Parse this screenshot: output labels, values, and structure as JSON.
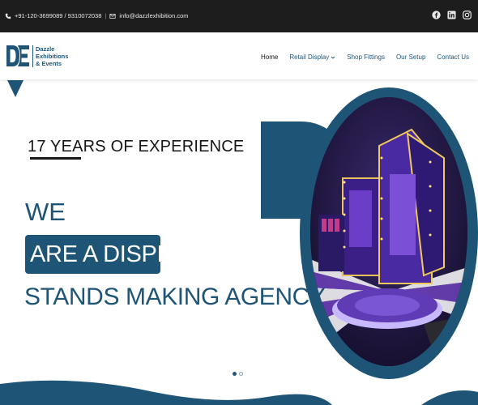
{
  "topbar": {
    "phone": "+91-120-3699089 / 9310072038",
    "email": "info@dazzlexhibition.com",
    "socials": [
      "facebook-icon",
      "linkedin-icon",
      "instagram-icon"
    ]
  },
  "header": {
    "logo_mark": "DE",
    "logo_lines": [
      "Dazzle",
      "Exhibitions",
      "& Events"
    ],
    "nav": [
      {
        "label": "Home",
        "active": true
      },
      {
        "label": "Retail Display",
        "dropdown": true
      },
      {
        "label": "Shop Fittings"
      },
      {
        "label": "Our Setup"
      },
      {
        "label": "Contact Us"
      }
    ]
  },
  "hero": {
    "experience": "17 YEARS OF EXPERIENCE",
    "line1": "WE",
    "line2": "ARE A DISPLAY",
    "line3": "STANDS MAKING AGENCY"
  },
  "slider": {
    "count": 2,
    "active": 0
  },
  "colors": {
    "brand": "#1e5577",
    "topbar": "#1d1d1d",
    "text_dark": "#161616"
  }
}
